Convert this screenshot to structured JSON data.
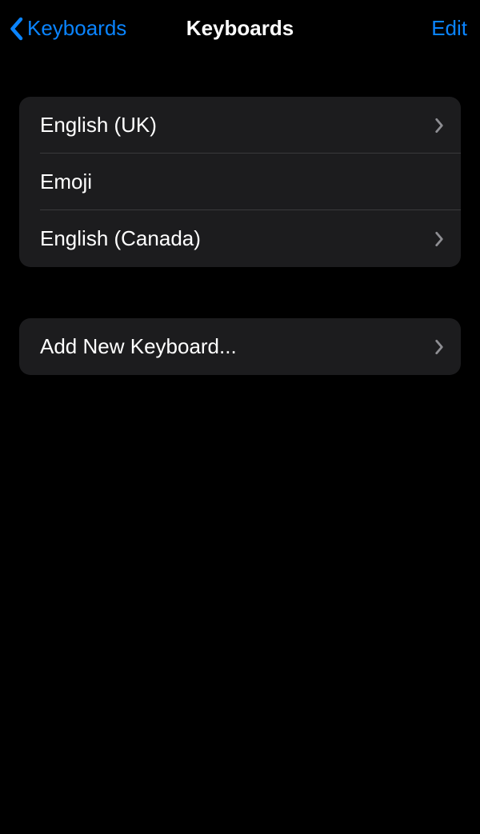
{
  "nav": {
    "back_label": "Keyboards",
    "title": "Keyboards",
    "edit_label": "Edit"
  },
  "keyboards": {
    "items": [
      {
        "label": "English (UK)",
        "has_chevron": true
      },
      {
        "label": "Emoji",
        "has_chevron": false
      },
      {
        "label": "English (Canada)",
        "has_chevron": true
      }
    ]
  },
  "actions": {
    "add_label": "Add New Keyboard..."
  }
}
